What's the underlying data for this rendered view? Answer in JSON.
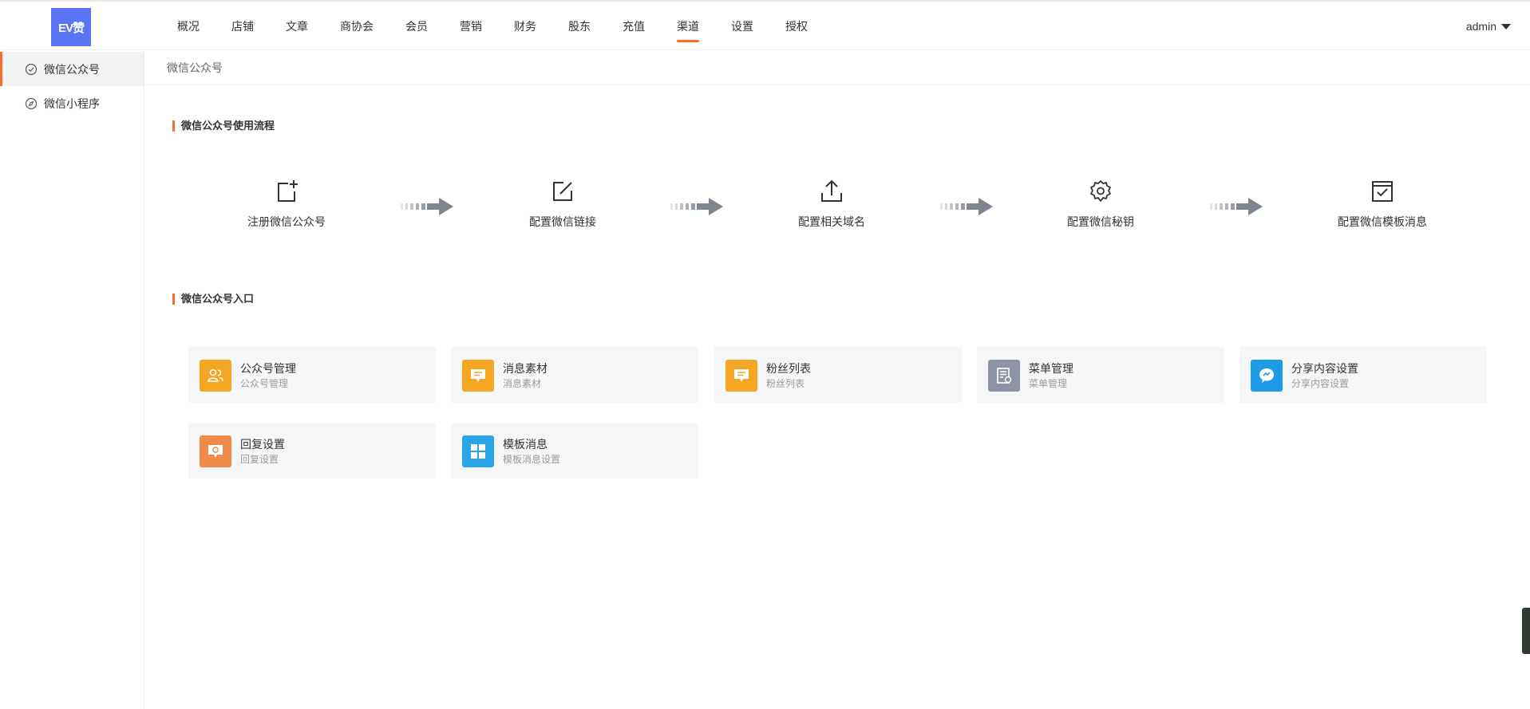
{
  "logo": {
    "text": "EV赞",
    "color": "#5b73f5"
  },
  "nav": {
    "items": [
      {
        "label": "概况"
      },
      {
        "label": "店铺"
      },
      {
        "label": "文章"
      },
      {
        "label": "商协会"
      },
      {
        "label": "会员"
      },
      {
        "label": "营销"
      },
      {
        "label": "财务"
      },
      {
        "label": "股东"
      },
      {
        "label": "充值"
      },
      {
        "label": "渠道",
        "active": true
      },
      {
        "label": "设置"
      },
      {
        "label": "授权"
      }
    ],
    "accent_color": "#ff6b2c"
  },
  "user": {
    "name": "admin"
  },
  "sidebar": {
    "items": [
      {
        "label": "微信公众号",
        "icon": "check-circle-icon",
        "active": true
      },
      {
        "label": "微信小程序",
        "icon": "compass-icon",
        "active": false
      }
    ]
  },
  "breadcrumb": {
    "label": "微信公众号"
  },
  "flow_section": {
    "title": "微信公众号使用流程",
    "steps": [
      {
        "label": "注册微信公众号",
        "icon": "add-square-icon"
      },
      {
        "label": "配置微信链接",
        "icon": "edit-icon"
      },
      {
        "label": "配置相关域名",
        "icon": "upload-icon"
      },
      {
        "label": "配置微信秘钥",
        "icon": "gear-icon"
      },
      {
        "label": "配置微信模板消息",
        "icon": "calendar-check-icon"
      }
    ]
  },
  "entry_section": {
    "title": "微信公众号入口",
    "cards": [
      {
        "title": "公众号管理",
        "sub": "公众号管理",
        "icon": "users-icon",
        "color": "#f5a623"
      },
      {
        "title": "消息素材",
        "sub": "消息素材",
        "icon": "message-icon",
        "color": "#f5a623"
      },
      {
        "title": "粉丝列表",
        "sub": "粉丝列表",
        "icon": "message-icon",
        "color": "#f5a623"
      },
      {
        "title": "菜单管理",
        "sub": "菜单管理",
        "icon": "menu-doc-icon",
        "color": "#8d94a5"
      },
      {
        "title": "分享内容设置",
        "sub": "分享内容设置",
        "icon": "share-chat-icon",
        "color": "#1e9be8"
      },
      {
        "title": "回复设置",
        "sub": "回复设置",
        "icon": "reply-icon",
        "color": "#f08a4b"
      },
      {
        "title": "模板消息",
        "sub": "模板消息设置",
        "icon": "grid-icon",
        "color": "#2aa6e8"
      }
    ]
  }
}
